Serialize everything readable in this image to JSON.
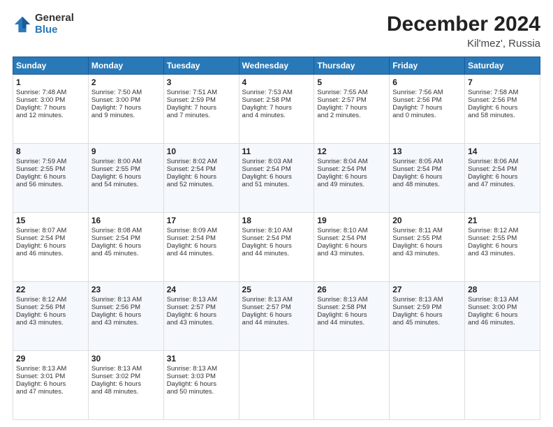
{
  "header": {
    "logo_general": "General",
    "logo_blue": "Blue",
    "month_title": "December 2024",
    "location": "Kil'mez', Russia"
  },
  "weekdays": [
    "Sunday",
    "Monday",
    "Tuesday",
    "Wednesday",
    "Thursday",
    "Friday",
    "Saturday"
  ],
  "weeks": [
    [
      {
        "day": "1",
        "lines": [
          "Sunrise: 7:48 AM",
          "Sunset: 3:00 PM",
          "Daylight: 7 hours",
          "and 12 minutes."
        ]
      },
      {
        "day": "2",
        "lines": [
          "Sunrise: 7:50 AM",
          "Sunset: 3:00 PM",
          "Daylight: 7 hours",
          "and 9 minutes."
        ]
      },
      {
        "day": "3",
        "lines": [
          "Sunrise: 7:51 AM",
          "Sunset: 2:59 PM",
          "Daylight: 7 hours",
          "and 7 minutes."
        ]
      },
      {
        "day": "4",
        "lines": [
          "Sunrise: 7:53 AM",
          "Sunset: 2:58 PM",
          "Daylight: 7 hours",
          "and 4 minutes."
        ]
      },
      {
        "day": "5",
        "lines": [
          "Sunrise: 7:55 AM",
          "Sunset: 2:57 PM",
          "Daylight: 7 hours",
          "and 2 minutes."
        ]
      },
      {
        "day": "6",
        "lines": [
          "Sunrise: 7:56 AM",
          "Sunset: 2:56 PM",
          "Daylight: 7 hours",
          "and 0 minutes."
        ]
      },
      {
        "day": "7",
        "lines": [
          "Sunrise: 7:58 AM",
          "Sunset: 2:56 PM",
          "Daylight: 6 hours",
          "and 58 minutes."
        ]
      }
    ],
    [
      {
        "day": "8",
        "lines": [
          "Sunrise: 7:59 AM",
          "Sunset: 2:55 PM",
          "Daylight: 6 hours",
          "and 56 minutes."
        ]
      },
      {
        "day": "9",
        "lines": [
          "Sunrise: 8:00 AM",
          "Sunset: 2:55 PM",
          "Daylight: 6 hours",
          "and 54 minutes."
        ]
      },
      {
        "day": "10",
        "lines": [
          "Sunrise: 8:02 AM",
          "Sunset: 2:54 PM",
          "Daylight: 6 hours",
          "and 52 minutes."
        ]
      },
      {
        "day": "11",
        "lines": [
          "Sunrise: 8:03 AM",
          "Sunset: 2:54 PM",
          "Daylight: 6 hours",
          "and 51 minutes."
        ]
      },
      {
        "day": "12",
        "lines": [
          "Sunrise: 8:04 AM",
          "Sunset: 2:54 PM",
          "Daylight: 6 hours",
          "and 49 minutes."
        ]
      },
      {
        "day": "13",
        "lines": [
          "Sunrise: 8:05 AM",
          "Sunset: 2:54 PM",
          "Daylight: 6 hours",
          "and 48 minutes."
        ]
      },
      {
        "day": "14",
        "lines": [
          "Sunrise: 8:06 AM",
          "Sunset: 2:54 PM",
          "Daylight: 6 hours",
          "and 47 minutes."
        ]
      }
    ],
    [
      {
        "day": "15",
        "lines": [
          "Sunrise: 8:07 AM",
          "Sunset: 2:54 PM",
          "Daylight: 6 hours",
          "and 46 minutes."
        ]
      },
      {
        "day": "16",
        "lines": [
          "Sunrise: 8:08 AM",
          "Sunset: 2:54 PM",
          "Daylight: 6 hours",
          "and 45 minutes."
        ]
      },
      {
        "day": "17",
        "lines": [
          "Sunrise: 8:09 AM",
          "Sunset: 2:54 PM",
          "Daylight: 6 hours",
          "and 44 minutes."
        ]
      },
      {
        "day": "18",
        "lines": [
          "Sunrise: 8:10 AM",
          "Sunset: 2:54 PM",
          "Daylight: 6 hours",
          "and 44 minutes."
        ]
      },
      {
        "day": "19",
        "lines": [
          "Sunrise: 8:10 AM",
          "Sunset: 2:54 PM",
          "Daylight: 6 hours",
          "and 43 minutes."
        ]
      },
      {
        "day": "20",
        "lines": [
          "Sunrise: 8:11 AM",
          "Sunset: 2:55 PM",
          "Daylight: 6 hours",
          "and 43 minutes."
        ]
      },
      {
        "day": "21",
        "lines": [
          "Sunrise: 8:12 AM",
          "Sunset: 2:55 PM",
          "Daylight: 6 hours",
          "and 43 minutes."
        ]
      }
    ],
    [
      {
        "day": "22",
        "lines": [
          "Sunrise: 8:12 AM",
          "Sunset: 2:56 PM",
          "Daylight: 6 hours",
          "and 43 minutes."
        ]
      },
      {
        "day": "23",
        "lines": [
          "Sunrise: 8:13 AM",
          "Sunset: 2:56 PM",
          "Daylight: 6 hours",
          "and 43 minutes."
        ]
      },
      {
        "day": "24",
        "lines": [
          "Sunrise: 8:13 AM",
          "Sunset: 2:57 PM",
          "Daylight: 6 hours",
          "and 43 minutes."
        ]
      },
      {
        "day": "25",
        "lines": [
          "Sunrise: 8:13 AM",
          "Sunset: 2:57 PM",
          "Daylight: 6 hours",
          "and 44 minutes."
        ]
      },
      {
        "day": "26",
        "lines": [
          "Sunrise: 8:13 AM",
          "Sunset: 2:58 PM",
          "Daylight: 6 hours",
          "and 44 minutes."
        ]
      },
      {
        "day": "27",
        "lines": [
          "Sunrise: 8:13 AM",
          "Sunset: 2:59 PM",
          "Daylight: 6 hours",
          "and 45 minutes."
        ]
      },
      {
        "day": "28",
        "lines": [
          "Sunrise: 8:13 AM",
          "Sunset: 3:00 PM",
          "Daylight: 6 hours",
          "and 46 minutes."
        ]
      }
    ],
    [
      {
        "day": "29",
        "lines": [
          "Sunrise: 8:13 AM",
          "Sunset: 3:01 PM",
          "Daylight: 6 hours",
          "and 47 minutes."
        ]
      },
      {
        "day": "30",
        "lines": [
          "Sunrise: 8:13 AM",
          "Sunset: 3:02 PM",
          "Daylight: 6 hours",
          "and 48 minutes."
        ]
      },
      {
        "day": "31",
        "lines": [
          "Sunrise: 8:13 AM",
          "Sunset: 3:03 PM",
          "Daylight: 6 hours",
          "and 50 minutes."
        ]
      },
      null,
      null,
      null,
      null
    ]
  ]
}
